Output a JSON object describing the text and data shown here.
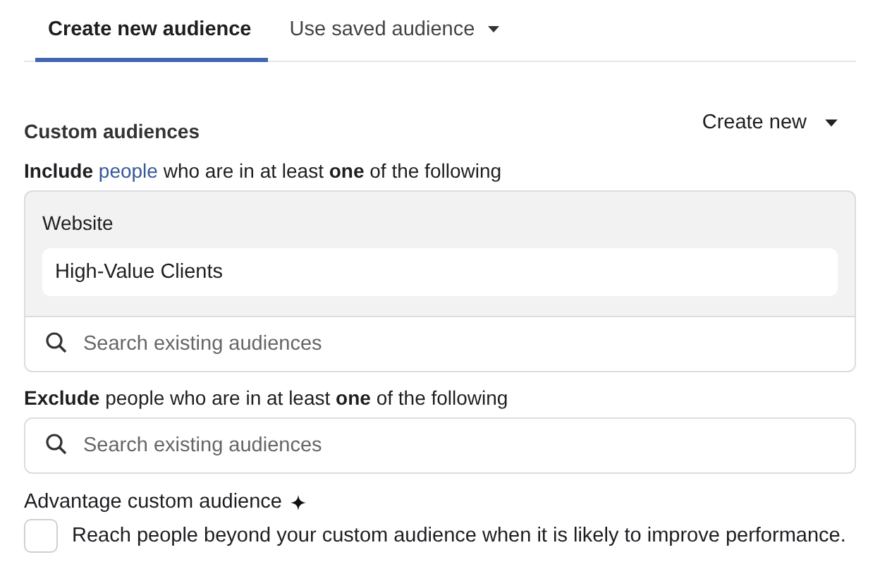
{
  "tabs": [
    {
      "label": "Create new audience",
      "selected": true,
      "dropdown": false
    },
    {
      "label": "Use saved audience",
      "selected": false,
      "dropdown": true
    }
  ],
  "custom_audiences": {
    "title": "Custom audiences",
    "create_button": "Create new",
    "include": {
      "before": "**Include**",
      "link": "people",
      "after": "who are in at least **one** of the following"
    },
    "included_group": {
      "label": "Website",
      "value": "High-Value Clients"
    },
    "include_search": {
      "placeholder": "Search existing audiences"
    },
    "exclude": {
      "text": "**Exclude** people who are in at least **one** of the following"
    },
    "exclude_search": {
      "placeholder": "Search existing audiences"
    }
  },
  "advantage": {
    "title": "Advantage custom audience",
    "option": {
      "label": "Reach people beyond your custom audience when it is likely to improve performance.",
      "checked": false
    }
  }
}
